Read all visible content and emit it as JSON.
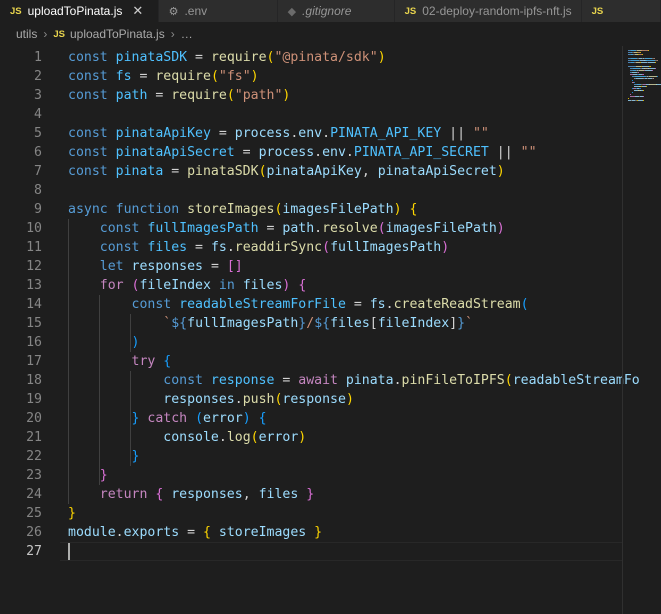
{
  "tabs": [
    {
      "icon": "js",
      "label": "uploadToPinata.js",
      "active": true,
      "close": "✕"
    },
    {
      "icon": "gear",
      "label": ".env"
    },
    {
      "icon": "git",
      "label": ".gitignore"
    },
    {
      "icon": "js",
      "label": "02-deploy-random-ipfs-nft.js"
    },
    {
      "icon": "js",
      "label": ""
    }
  ],
  "breadcrumb": {
    "folder": "utils",
    "file": "uploadToPinata.js",
    "more": "…",
    "sep": "›"
  },
  "editor": {
    "current_line": 27,
    "lines": [
      {
        "n": "1",
        "tokens": [
          [
            "k",
            "const "
          ],
          [
            "n",
            "pinataSDK"
          ],
          [
            "p",
            " = "
          ],
          [
            "f",
            "require"
          ],
          [
            "b1",
            "("
          ],
          [
            "s",
            "\"@pinata/sdk\""
          ],
          [
            "b1",
            ")"
          ]
        ]
      },
      {
        "n": "2",
        "tokens": [
          [
            "k",
            "const "
          ],
          [
            "n",
            "fs"
          ],
          [
            "p",
            " = "
          ],
          [
            "f",
            "require"
          ],
          [
            "b1",
            "("
          ],
          [
            "s",
            "\"fs\""
          ],
          [
            "b1",
            ")"
          ]
        ]
      },
      {
        "n": "3",
        "tokens": [
          [
            "k",
            "const "
          ],
          [
            "n",
            "path"
          ],
          [
            "p",
            " = "
          ],
          [
            "f",
            "require"
          ],
          [
            "b1",
            "("
          ],
          [
            "s",
            "\"path\""
          ],
          [
            "b1",
            ")"
          ]
        ]
      },
      {
        "n": "4",
        "tokens": []
      },
      {
        "n": "5",
        "tokens": [
          [
            "k",
            "const "
          ],
          [
            "n",
            "pinataApiKey"
          ],
          [
            "p",
            " = "
          ],
          [
            "v",
            "process"
          ],
          [
            "p",
            "."
          ],
          [
            "v",
            "env"
          ],
          [
            "p",
            "."
          ],
          [
            "n",
            "PINATA_API_KEY"
          ],
          [
            "p",
            " || "
          ],
          [
            "s",
            "\"\""
          ]
        ]
      },
      {
        "n": "6",
        "tokens": [
          [
            "k",
            "const "
          ],
          [
            "n",
            "pinataApiSecret"
          ],
          [
            "p",
            " = "
          ],
          [
            "v",
            "process"
          ],
          [
            "p",
            "."
          ],
          [
            "v",
            "env"
          ],
          [
            "p",
            "."
          ],
          [
            "n",
            "PINATA_API_SECRET"
          ],
          [
            "p",
            " || "
          ],
          [
            "s",
            "\"\""
          ]
        ]
      },
      {
        "n": "7",
        "tokens": [
          [
            "k",
            "const "
          ],
          [
            "n",
            "pinata"
          ],
          [
            "p",
            " = "
          ],
          [
            "f",
            "pinataSDK"
          ],
          [
            "b1",
            "("
          ],
          [
            "v",
            "pinataApiKey"
          ],
          [
            "p",
            ", "
          ],
          [
            "v",
            "pinataApiSecret"
          ],
          [
            "b1",
            ")"
          ]
        ]
      },
      {
        "n": "8",
        "tokens": []
      },
      {
        "n": "9",
        "tokens": [
          [
            "k",
            "async "
          ],
          [
            "k",
            "function "
          ],
          [
            "f",
            "storeImages"
          ],
          [
            "b1",
            "("
          ],
          [
            "v",
            "imagesFilePath"
          ],
          [
            "b1",
            ")"
          ],
          [
            "p",
            " "
          ],
          [
            "b1",
            "{"
          ]
        ]
      },
      {
        "n": "10",
        "tokens": [
          [
            "p",
            "    "
          ],
          [
            "k",
            "const "
          ],
          [
            "n",
            "fullImagesPath"
          ],
          [
            "p",
            " = "
          ],
          [
            "v",
            "path"
          ],
          [
            "p",
            "."
          ],
          [
            "f",
            "resolve"
          ],
          [
            "b2",
            "("
          ],
          [
            "v",
            "imagesFilePath"
          ],
          [
            "b2",
            ")"
          ]
        ]
      },
      {
        "n": "11",
        "tokens": [
          [
            "p",
            "    "
          ],
          [
            "k",
            "const "
          ],
          [
            "n",
            "files"
          ],
          [
            "p",
            " = "
          ],
          [
            "v",
            "fs"
          ],
          [
            "p",
            "."
          ],
          [
            "f",
            "readdirSync"
          ],
          [
            "b2",
            "("
          ],
          [
            "v",
            "fullImagesPath"
          ],
          [
            "b2",
            ")"
          ]
        ]
      },
      {
        "n": "12",
        "tokens": [
          [
            "p",
            "    "
          ],
          [
            "k",
            "let "
          ],
          [
            "v",
            "responses"
          ],
          [
            "p",
            " = "
          ],
          [
            "b2",
            "[]"
          ]
        ]
      },
      {
        "n": "13",
        "tokens": [
          [
            "p",
            "    "
          ],
          [
            "c",
            "for "
          ],
          [
            "b2",
            "("
          ],
          [
            "v",
            "fileIndex"
          ],
          [
            "k",
            " in "
          ],
          [
            "v",
            "files"
          ],
          [
            "b2",
            ")"
          ],
          [
            "p",
            " "
          ],
          [
            "b2",
            "{"
          ]
        ]
      },
      {
        "n": "14",
        "tokens": [
          [
            "p",
            "        "
          ],
          [
            "k",
            "const "
          ],
          [
            "n",
            "readableStreamForFile"
          ],
          [
            "p",
            " = "
          ],
          [
            "v",
            "fs"
          ],
          [
            "p",
            "."
          ],
          [
            "f",
            "createReadStream"
          ],
          [
            "b3",
            "("
          ]
        ]
      },
      {
        "n": "15",
        "tokens": [
          [
            "p",
            "            "
          ],
          [
            "s",
            "`"
          ],
          [
            "k",
            "${"
          ],
          [
            "v",
            "fullImagesPath"
          ],
          [
            "k",
            "}"
          ],
          [
            "s",
            "/"
          ],
          [
            "k",
            "${"
          ],
          [
            "v",
            "files"
          ],
          [
            "p",
            "["
          ],
          [
            "v",
            "fileIndex"
          ],
          [
            "p",
            "]"
          ],
          [
            "k",
            "}"
          ],
          [
            "s",
            "`"
          ]
        ]
      },
      {
        "n": "16",
        "tokens": [
          [
            "p",
            "        "
          ],
          [
            "b3",
            ")"
          ]
        ]
      },
      {
        "n": "17",
        "tokens": [
          [
            "p",
            "        "
          ],
          [
            "c",
            "try "
          ],
          [
            "b3",
            "{"
          ]
        ]
      },
      {
        "n": "18",
        "tokens": [
          [
            "p",
            "            "
          ],
          [
            "k",
            "const "
          ],
          [
            "n",
            "response"
          ],
          [
            "p",
            " = "
          ],
          [
            "c",
            "await "
          ],
          [
            "v",
            "pinata"
          ],
          [
            "p",
            "."
          ],
          [
            "f",
            "pinFileToIPFS"
          ],
          [
            "b1",
            "("
          ],
          [
            "v",
            "readableStreamFo"
          ]
        ]
      },
      {
        "n": "19",
        "tokens": [
          [
            "p",
            "            "
          ],
          [
            "v",
            "responses"
          ],
          [
            "p",
            "."
          ],
          [
            "f",
            "push"
          ],
          [
            "b1",
            "("
          ],
          [
            "v",
            "response"
          ],
          [
            "b1",
            ")"
          ]
        ]
      },
      {
        "n": "20",
        "tokens": [
          [
            "p",
            "        "
          ],
          [
            "b3",
            "}"
          ],
          [
            "c",
            " catch "
          ],
          [
            "b3",
            "("
          ],
          [
            "v",
            "error"
          ],
          [
            "b3",
            ")"
          ],
          [
            "p",
            " "
          ],
          [
            "b3",
            "{"
          ]
        ]
      },
      {
        "n": "21",
        "tokens": [
          [
            "p",
            "            "
          ],
          [
            "v",
            "console"
          ],
          [
            "p",
            "."
          ],
          [
            "f",
            "log"
          ],
          [
            "b1",
            "("
          ],
          [
            "v",
            "error"
          ],
          [
            "b1",
            ")"
          ]
        ]
      },
      {
        "n": "22",
        "tokens": [
          [
            "p",
            "        "
          ],
          [
            "b3",
            "}"
          ]
        ]
      },
      {
        "n": "23",
        "tokens": [
          [
            "p",
            "    "
          ],
          [
            "b2",
            "}"
          ]
        ]
      },
      {
        "n": "24",
        "tokens": [
          [
            "p",
            "    "
          ],
          [
            "c",
            "return "
          ],
          [
            "b2",
            "{ "
          ],
          [
            "v",
            "responses"
          ],
          [
            "p",
            ", "
          ],
          [
            "v",
            "files"
          ],
          [
            "b2",
            " }"
          ]
        ]
      },
      {
        "n": "25",
        "tokens": [
          [
            "b1",
            "}"
          ]
        ]
      },
      {
        "n": "26",
        "tokens": [
          [
            "v",
            "module"
          ],
          [
            "p",
            "."
          ],
          [
            "v",
            "exports"
          ],
          [
            "p",
            " = "
          ],
          [
            "b1",
            "{ "
          ],
          [
            "v",
            "storeImages"
          ],
          [
            "b1",
            " }"
          ]
        ]
      },
      {
        "n": "27",
        "tokens": []
      }
    ]
  },
  "colors": {
    "background": "#1e1e1e",
    "keyword": "#569cd6",
    "control": "#c586c0",
    "variable": "#9cdcfe",
    "constant": "#4fc1ff",
    "function": "#dcdcaa",
    "string": "#ce9178"
  }
}
